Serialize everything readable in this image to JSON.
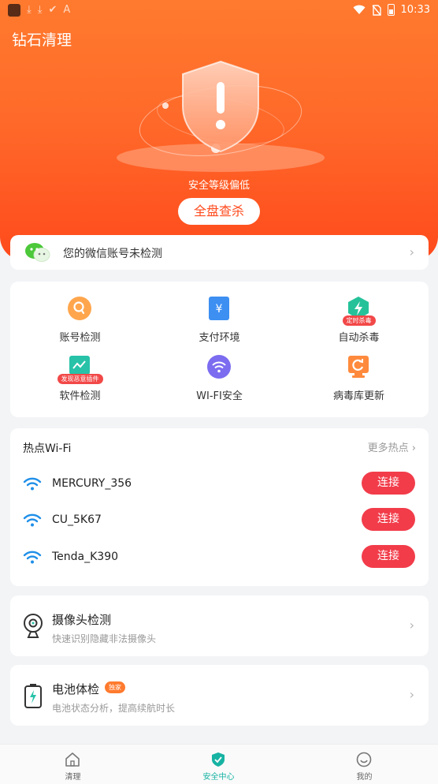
{
  "status_bar": {
    "time": "10:33",
    "left_glyphs": [
      "⤓",
      "⤓",
      "✔",
      "A"
    ]
  },
  "app": {
    "title": "钻石清理"
  },
  "hero": {
    "status_text": "安全等级偏低",
    "scan_button": "全盘查杀"
  },
  "wechat_notice": {
    "text": "您的微信账号未检测"
  },
  "features": [
    {
      "label": "账号检测",
      "icon": "account-search-icon",
      "badge": ""
    },
    {
      "label": "支付环境",
      "icon": "payment-yen-icon",
      "badge": ""
    },
    {
      "label": "自动杀毒",
      "icon": "auto-antivirus-icon",
      "badge": "定时杀毒"
    },
    {
      "label": "软件检测",
      "icon": "software-scan-icon",
      "badge": "发现恶意插件"
    },
    {
      "label": "WI-FI安全",
      "icon": "wifi-security-icon",
      "badge": ""
    },
    {
      "label": "病毒库更新",
      "icon": "virus-db-update-icon",
      "badge": ""
    }
  ],
  "wifi": {
    "title": "热点Wi-Fi",
    "more": "更多热点",
    "connect_label": "连接",
    "networks": [
      {
        "ssid": "MERCURY_356"
      },
      {
        "ssid": "CU_5K67"
      },
      {
        "ssid": "Tenda_K390"
      }
    ]
  },
  "camera_check": {
    "title": "摄像头检测",
    "subtitle": "快速识别隐藏非法摄像头"
  },
  "battery_check": {
    "title": "电池体检",
    "badge": "独家",
    "subtitle": "电池状态分析，提高续航时长"
  },
  "tabs": [
    {
      "label": "清理",
      "active": false
    },
    {
      "label": "安全中心",
      "active": true
    },
    {
      "label": "我的",
      "active": false
    }
  ],
  "colors": {
    "hero_orange": "#ff6a2a",
    "connect_red": "#f23c4a",
    "active_tab": "#17b3a3",
    "wifi_blue": "#1f8fe8"
  }
}
